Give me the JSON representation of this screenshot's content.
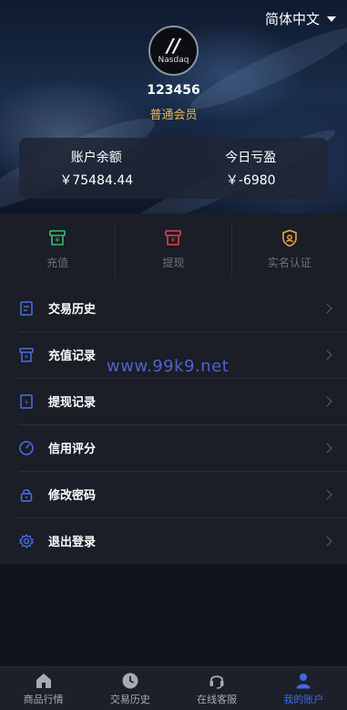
{
  "header": {
    "language": "简体中文"
  },
  "profile": {
    "avatar_logo_text": "Nasdaq",
    "user_id": "123456",
    "member_level": "普通会员"
  },
  "stats": [
    {
      "label": "账户余额",
      "value": "￥75484.44"
    },
    {
      "label": "今日亏盈",
      "value": "￥-6980"
    }
  ],
  "quick_actions": [
    {
      "label": "充值",
      "icon": "deposit-icon",
      "color": "#3bbf6a"
    },
    {
      "label": "提现",
      "icon": "withdraw-icon",
      "color": "#e0404d"
    },
    {
      "label": "实名认证",
      "icon": "verify-shield-icon",
      "color": "#f0a233"
    }
  ],
  "menu": [
    {
      "label": "交易历史",
      "icon": "document-icon"
    },
    {
      "label": "充值记录",
      "icon": "deposit-record-icon"
    },
    {
      "label": "提现记录",
      "icon": "withdraw-record-icon"
    },
    {
      "label": "信用评分",
      "icon": "gauge-icon"
    },
    {
      "label": "修改密码",
      "icon": "lock-icon"
    },
    {
      "label": "退出登录",
      "icon": "gear-icon"
    }
  ],
  "watermark": "www.99k9.net",
  "tabbar": [
    {
      "label": "商品行情",
      "icon": "home-icon",
      "active": false
    },
    {
      "label": "交易历史",
      "icon": "clock-icon",
      "active": false
    },
    {
      "label": "在线客服",
      "icon": "headset-icon",
      "active": false
    },
    {
      "label": "我的账户",
      "icon": "user-icon",
      "active": true
    }
  ],
  "colors": {
    "accent": "#3f68e6",
    "gold": "#e5b84a",
    "menu_icon": "#4a6fe0"
  }
}
